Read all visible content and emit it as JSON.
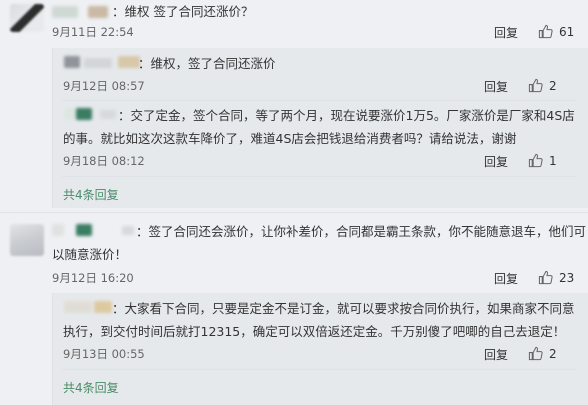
{
  "comments": [
    {
      "text": "：维权 签了合同还涨价？",
      "time": "9月11日 22:54",
      "reply_label": "回复",
      "likes": "61",
      "replies": [
        {
          "text": "：维权，签了合同还涨价",
          "time": "9月12日 08:57",
          "reply_label": "回复",
          "likes": "2"
        },
        {
          "text_line1": "：交了定金，签个合同，等了两个月，现在说要涨价1万5。厂家涨价是厂家和4S店",
          "text_line2": "的事。就比如这次这款车降价了，难道4S店会把钱退给消费者吗？请给说法，谢谢",
          "time": "9月18日 08:12",
          "reply_label": "回复",
          "likes": "1"
        }
      ],
      "more": "共4条回复"
    },
    {
      "text_line1": "：签了合同还会涨价，让你补差价，合同都是霸王条款，你不能随意退车，他们可",
      "text_line2": "以随意涨价！",
      "time": "9月12日 16:20",
      "reply_label": "回复",
      "likes": "23",
      "replies": [
        {
          "text_line1": "：大家看下合同，只要是定金不是订金，就可以要求按合同价执行，如果商家不同意",
          "text_line2": "执行，到交付时间后就打12315，确定可以双倍返还定金。千万别傻了吧唧的自己去退定！",
          "time": "9月13日 00:55",
          "reply_label": "回复",
          "likes": "2"
        }
      ],
      "more": "共4条回复"
    }
  ]
}
